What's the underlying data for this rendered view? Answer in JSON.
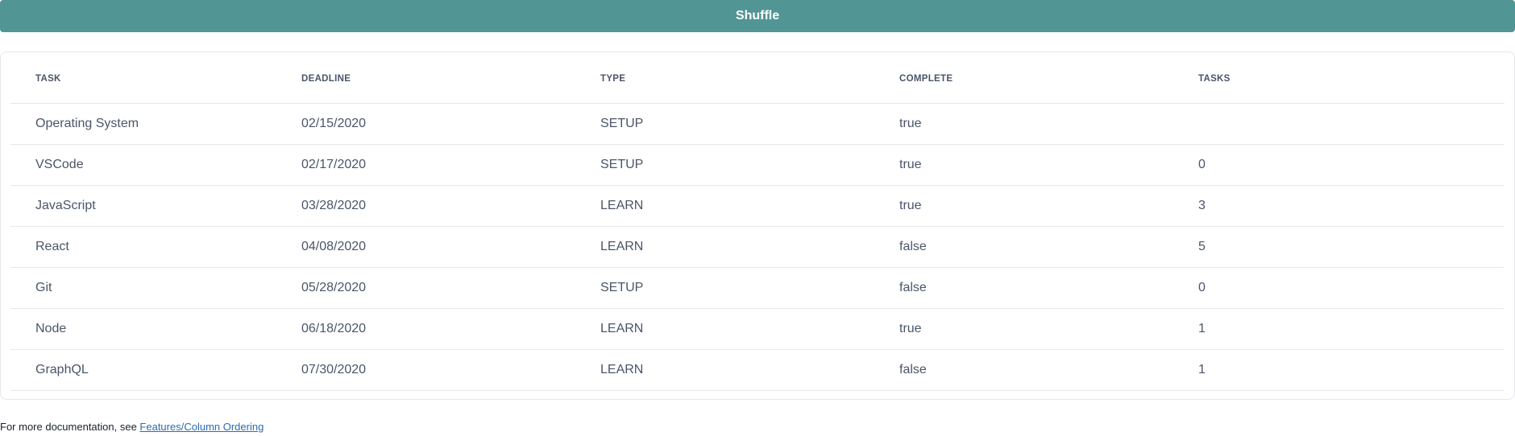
{
  "shuffle_button": {
    "label": "Shuffle"
  },
  "colors": {
    "button_bg": "#519594",
    "button_text": "#ffffff",
    "link": "#2b6cb0",
    "text": "#4a5568"
  },
  "table": {
    "headers": [
      "TASK",
      "DEADLINE",
      "TYPE",
      "COMPLETE",
      "TASKS"
    ],
    "rows": [
      [
        "Operating System",
        "02/15/2020",
        "SETUP",
        "true",
        ""
      ],
      [
        "VSCode",
        "02/17/2020",
        "SETUP",
        "true",
        "0"
      ],
      [
        "JavaScript",
        "03/28/2020",
        "LEARN",
        "true",
        "3"
      ],
      [
        "React",
        "04/08/2020",
        "LEARN",
        "false",
        "5"
      ],
      [
        "Git",
        "05/28/2020",
        "SETUP",
        "false",
        "0"
      ],
      [
        "Node",
        "06/18/2020",
        "LEARN",
        "true",
        "1"
      ],
      [
        "GraphQL",
        "07/30/2020",
        "LEARN",
        "false",
        "1"
      ]
    ]
  },
  "footer": {
    "text": "For more documentation, see ",
    "link_label": "Features/Column Ordering"
  }
}
